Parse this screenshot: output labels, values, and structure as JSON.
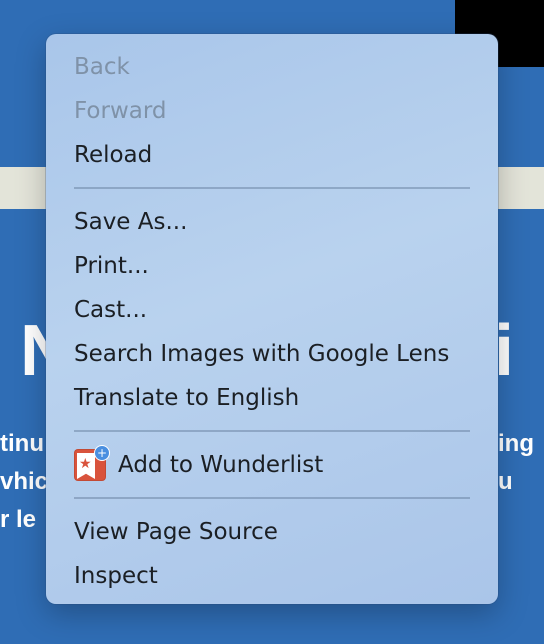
{
  "background": {
    "headline_left": "N",
    "headline_right": "ti",
    "text_rows": [
      {
        "left": "tinu",
        "right": "uying"
      },
      {
        "left": "vhic",
        "right": "d, u"
      },
      {
        "left": "r le",
        "right": ""
      }
    ]
  },
  "context_menu": {
    "items": [
      {
        "label": "Back",
        "enabled": false
      },
      {
        "label": "Forward",
        "enabled": false
      },
      {
        "label": "Reload",
        "enabled": true
      },
      {
        "label": "Save As...",
        "enabled": true
      },
      {
        "label": "Print...",
        "enabled": true
      },
      {
        "label": "Cast...",
        "enabled": true
      },
      {
        "label": "Search Images with Google Lens",
        "enabled": true
      },
      {
        "label": "Translate to English",
        "enabled": true
      },
      {
        "label": "Add to Wunderlist",
        "enabled": true,
        "icon": "wunderlist-icon"
      },
      {
        "label": "View Page Source",
        "enabled": true
      },
      {
        "label": "Inspect",
        "enabled": true
      }
    ]
  },
  "colors": {
    "page_background": "#2f6db5",
    "menu_background": "#b3cdec",
    "disabled_text": "#7f92a8",
    "text": "#1b1f24",
    "wunderlist_red": "#d9533c"
  }
}
